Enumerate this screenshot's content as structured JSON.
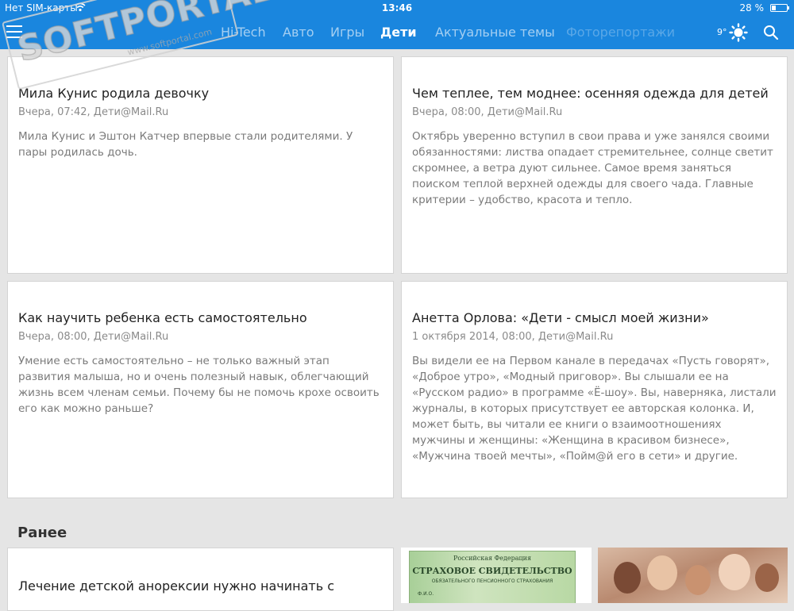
{
  "status_bar": {
    "carrier": "Нет SIM-карты",
    "time": "13:46",
    "battery": "28 %",
    "battery_level": 0.28
  },
  "nav": {
    "tabs": [
      {
        "label": "Hi-Tech",
        "state": "normal"
      },
      {
        "label": "Авто",
        "state": "normal"
      },
      {
        "label": "Игры",
        "state": "normal"
      },
      {
        "label": "Дети",
        "state": "active"
      },
      {
        "label": "Актуальные темы",
        "state": "normal"
      },
      {
        "label": "Фоторепортажи",
        "state": "faded"
      }
    ],
    "weather": "9°"
  },
  "watermark": {
    "text": "SOFTPORTAL",
    "sub": "www.softportal.com",
    "tm": "TM"
  },
  "cards": [
    {
      "title": "Мила Кунис родила девочку",
      "meta": "Вчера, 07:42, Дети@Mail.Ru",
      "desc": "Мила Кунис и Эштон Катчер впервые стали родителями. У пары родилась дочь."
    },
    {
      "title": "Чем теплее, тем моднее: осенняя одежда для детей",
      "meta": "Вчера, 08:00, Дети@Mail.Ru",
      "desc": "Октябрь уверенно вступил в свои права и уже занялся своими обязанностями: листва опадает стремительнее, солнце светит скромнее, а ветра дуют сильнее. Самое время заняться поиском теплой верхней одежды для своего чада. Главные критерии – удобство, красота и тепло."
    },
    {
      "title": "Как научить ребенка есть самостоятельно",
      "meta": "Вчера, 08:00, Дети@Mail.Ru",
      "desc": "Умение есть самостоятельно – не только важный этап развития малыша, но и очень полезный навык, облегчающий жизнь всем членам семьи. Почему бы не помочь крохе освоить его как можно раньше?"
    },
    {
      "title": "Анетта Орлова: «Дети - смысл моей жизни»",
      "meta": "1 октября 2014, 08:00, Дети@Mail.Ru",
      "desc": "Вы видели ее на Первом канале в передачах «Пусть говорят», «Доброе утро», «Модный приговор». Вы слышали ее на «Русском радио» в программе «Ё-шоу». Вы, наверняка, листали журналы, в которых присутствует ее авторская колонка. И, может быть, вы читали ее книги о взаимоотношениях мужчины и женщины: «Женщина в красивом бизнесе», «Мужчина твоей мечты», «Пойм@й его в сети» и другие."
    }
  ],
  "earlier": {
    "heading": "Ранее",
    "card_title": "Лечение детской анорексии нужно начинать с",
    "certificate": {
      "line1": "Российская Федерация",
      "line2": "СТРАХОВОЕ СВИДЕТЕЛЬСТВО",
      "line3": "ОБЯЗАТЕЛЬНОГО ПЕНСИОННОГО СТРАХОВАНИЯ",
      "line4": "Ф.И.О."
    }
  },
  "colors": {
    "topbar": "#1a86de",
    "background": "#e5e5e5"
  }
}
